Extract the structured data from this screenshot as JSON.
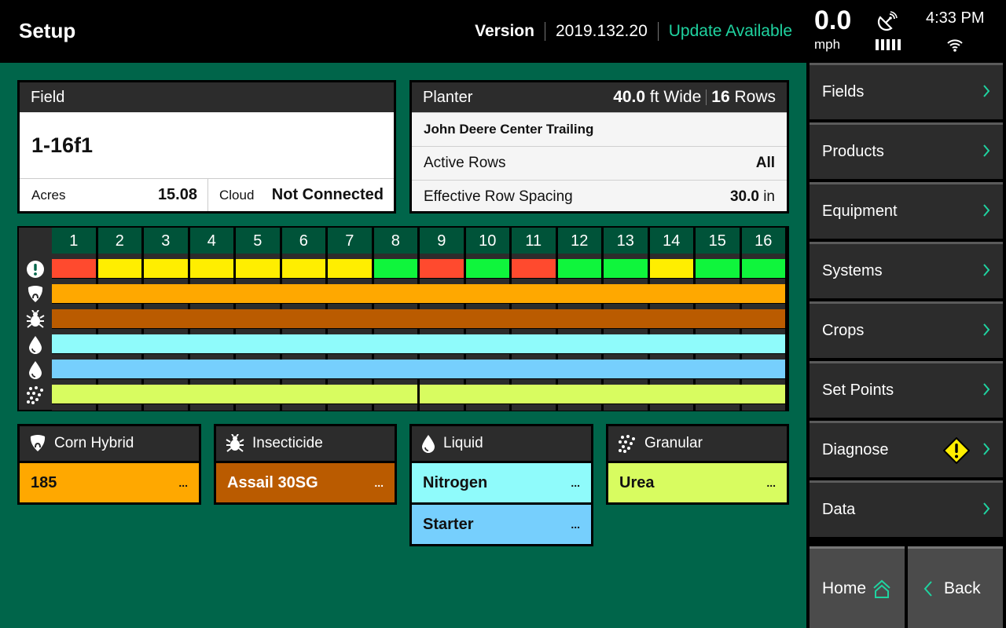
{
  "header": {
    "title": "Setup",
    "version_label": "Version",
    "version_number": "2019.132.20",
    "update_status": "Update Available",
    "speed_value": "0.0",
    "speed_unit": "mph",
    "gps_icon": "satellite-dish-icon",
    "gps_signal_bars": 5,
    "time": "4:33 PM",
    "wifi_icon": "wifi-icon"
  },
  "field": {
    "heading": "Field",
    "name": "1-16f1",
    "acres_label": "Acres",
    "acres_value": "15.08",
    "cloud_label": "Cloud",
    "cloud_value": "Not Connected"
  },
  "planter": {
    "heading": "Planter",
    "width_value": "40.0",
    "width_unit": "ft Wide",
    "rows_value": "16",
    "rows_unit": "Rows",
    "model": "John Deere Center Trailing",
    "active_rows_label": "Active Rows",
    "active_rows_value": "All",
    "spacing_label": "Effective Row Spacing",
    "spacing_value": "30.0",
    "spacing_unit": "in"
  },
  "row_grid": {
    "columns": [
      "1",
      "2",
      "3",
      "4",
      "5",
      "6",
      "7",
      "8",
      "9",
      "10",
      "11",
      "12",
      "13",
      "14",
      "15",
      "16"
    ],
    "status_colors": {
      "red": "#ff4a2e",
      "yellow": "#ffee00",
      "green": "#0ff53c"
    },
    "bands": [
      {
        "name": "status",
        "icon": "alert-circle-icon",
        "cells": [
          "red",
          "yellow",
          "yellow",
          "yellow",
          "yellow",
          "yellow",
          "yellow",
          "green",
          "red",
          "green",
          "red",
          "green",
          "green",
          "yellow",
          "green",
          "green"
        ]
      },
      {
        "name": "corn-hybrid",
        "icon": "seed-icon",
        "color": "#ffa800",
        "segments": [
          16
        ]
      },
      {
        "name": "insecticide",
        "icon": "bug-icon",
        "color": "#ba5b00",
        "segments": [
          16
        ]
      },
      {
        "name": "liquid-nitrogen",
        "icon": "droplet-icon",
        "color": "#8ffbfb",
        "segments": [
          16
        ]
      },
      {
        "name": "liquid-starter",
        "icon": "droplet-icon",
        "color": "#76cffd",
        "segments": [
          16
        ]
      },
      {
        "name": "granular",
        "icon": "granules-icon",
        "color": "#d8fc60",
        "segments": [
          8,
          8
        ]
      }
    ]
  },
  "products": [
    {
      "heading": "Corn Hybrid",
      "icon": "seed-icon",
      "items": [
        {
          "label": "185",
          "more": "...",
          "bg": "#ffa800",
          "fg": "#111111"
        }
      ]
    },
    {
      "heading": "Insecticide",
      "icon": "bug-icon",
      "items": [
        {
          "label": "Assail 30SG",
          "more": "...",
          "bg": "#ba5b00",
          "fg": "#ffffff"
        }
      ]
    },
    {
      "heading": "Liquid",
      "icon": "droplet-icon",
      "items": [
        {
          "label": "Nitrogen",
          "more": "...",
          "bg": "#8ffbfb",
          "fg": "#111111"
        },
        {
          "label": "Starter",
          "more": "...",
          "bg": "#76cffd",
          "fg": "#111111"
        }
      ]
    },
    {
      "heading": "Granular",
      "icon": "granules-icon",
      "items": [
        {
          "label": "Urea",
          "more": "...",
          "bg": "#d8fc60",
          "fg": "#111111"
        }
      ]
    }
  ],
  "nav": {
    "items": [
      {
        "label": "Fields",
        "warning": false
      },
      {
        "label": "Products",
        "warning": false
      },
      {
        "label": "Equipment",
        "warning": false
      },
      {
        "label": "Systems",
        "warning": false
      },
      {
        "label": "Crops",
        "warning": false
      },
      {
        "label": "Set Points",
        "warning": false
      },
      {
        "label": "Diagnose",
        "warning": true
      },
      {
        "label": "Data",
        "warning": false
      }
    ],
    "home_label": "Home",
    "back_label": "Back",
    "accent": "#1fd3a0"
  }
}
